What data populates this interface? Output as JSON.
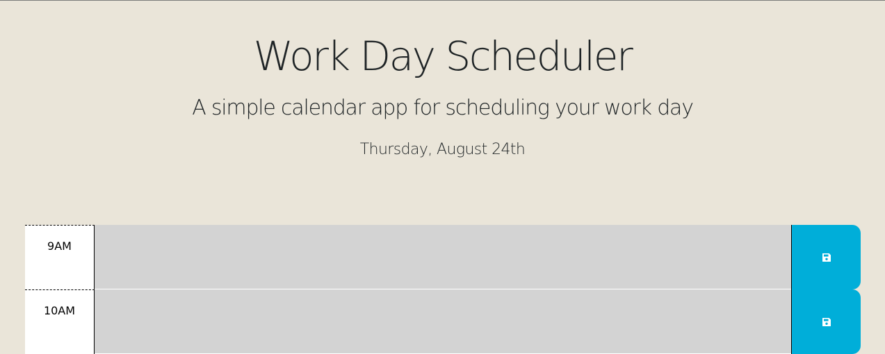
{
  "header": {
    "title": "Work Day Scheduler",
    "subtitle": "A simple calendar app for scheduling your work day",
    "current_day": "Thursday, August 24th"
  },
  "time_blocks": [
    {
      "hour": "9AM",
      "description": "",
      "save_icon": "floppy-disk-icon"
    },
    {
      "hour": "10AM",
      "description": "",
      "save_icon": "floppy-disk-icon"
    }
  ],
  "colors": {
    "page_background": "#eae5d9",
    "past_block": "#d3d3d3",
    "save_button": "#00aed9",
    "text": "#1f2426"
  }
}
